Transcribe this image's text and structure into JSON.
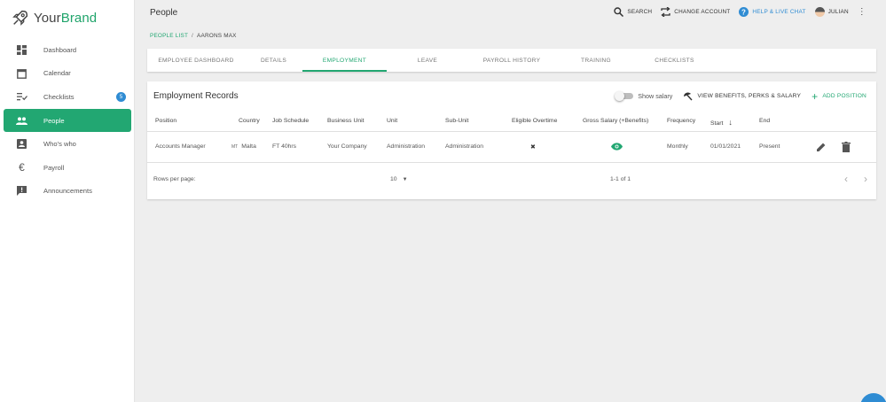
{
  "brand": {
    "name_part1": "Your",
    "name_part2": "Brand"
  },
  "sidebar": {
    "items": [
      {
        "label": "Dashboard",
        "icon": "dashboard-icon"
      },
      {
        "label": "Calendar",
        "icon": "calendar-icon"
      },
      {
        "label": "Checklists",
        "icon": "checklist-icon",
        "badge": "5"
      },
      {
        "label": "People",
        "icon": "people-icon",
        "active": true
      },
      {
        "label": "Who's who",
        "icon": "contact-card-icon"
      },
      {
        "label": "Payroll",
        "icon": "euro-icon"
      },
      {
        "label": "Announcements",
        "icon": "announcement-icon"
      }
    ]
  },
  "header": {
    "title": "People",
    "search_label": "SEARCH",
    "change_account_label": "CHANGE ACCOUNT",
    "help_label": "HELP & LIVE CHAT",
    "user_name": "JULIAN"
  },
  "breadcrumb": {
    "link": "PEOPLE LIST",
    "separator": "/",
    "current": "AARONS MAX"
  },
  "tabs": [
    {
      "label": "EMPLOYEE DASHBOARD"
    },
    {
      "label": "DETAILS"
    },
    {
      "label": "EMPLOYMENT",
      "active": true
    },
    {
      "label": "LEAVE"
    },
    {
      "label": "PAYROLL HISTORY"
    },
    {
      "label": "TRAINING"
    },
    {
      "label": "CHECKLISTS"
    }
  ],
  "records": {
    "title": "Employment Records",
    "show_salary_label": "Show salary",
    "benefits_label": "VIEW BENEFITS, PERKS & SALARY",
    "add_label": "ADD POSITION",
    "columns": [
      "Position",
      "Country",
      "Job Schedule",
      "Business Unit",
      "Unit",
      "Sub-Unit",
      "Eligible Overtime",
      "Gross Salary (+Benefits)",
      "Frequency",
      "Start",
      "End"
    ],
    "rows": [
      {
        "position": "Accounts Manager",
        "country_code": "MT",
        "country": "Malta",
        "schedule": "FT 40hrs",
        "business_unit": "Your Company",
        "unit": "Administration",
        "sub_unit": "Administration",
        "overtime": "✖",
        "frequency": "Monthly",
        "start": "01/01/2021",
        "end": "Present"
      }
    ],
    "footer": {
      "rows_per_page_label": "Rows per page:",
      "rows_per_page": "10",
      "range": "1-1 of 1"
    }
  },
  "colors": {
    "accent": "#22a772",
    "link_blue": "#2f8cd3"
  }
}
